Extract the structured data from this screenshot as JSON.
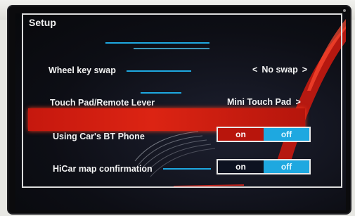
{
  "screen": {
    "title": "Setup",
    "colors": {
      "accent_blue": "#1ea8e0",
      "highlight_red": "#d41f12",
      "text": "#f3f3f3"
    },
    "rows": [
      {
        "label": "Wheel key swap",
        "value": "No swap",
        "left_icon": "chevron-left-icon",
        "right_icon": "chevron-right-icon",
        "left_glyph": "<",
        "right_glyph": ">"
      },
      {
        "label": "Touch Pad/Remote Lever",
        "value": "Mini Touch Pad",
        "right_icon": "chevron-right-icon",
        "right_glyph": ">"
      },
      {
        "label": "Using Car's BT Phone",
        "on_label": "on",
        "off_label": "off",
        "selected": "on",
        "highlighted": true
      },
      {
        "label": "HiCar map confirmation",
        "on_label": "on",
        "off_label": "off",
        "selected": "on"
      }
    ]
  }
}
